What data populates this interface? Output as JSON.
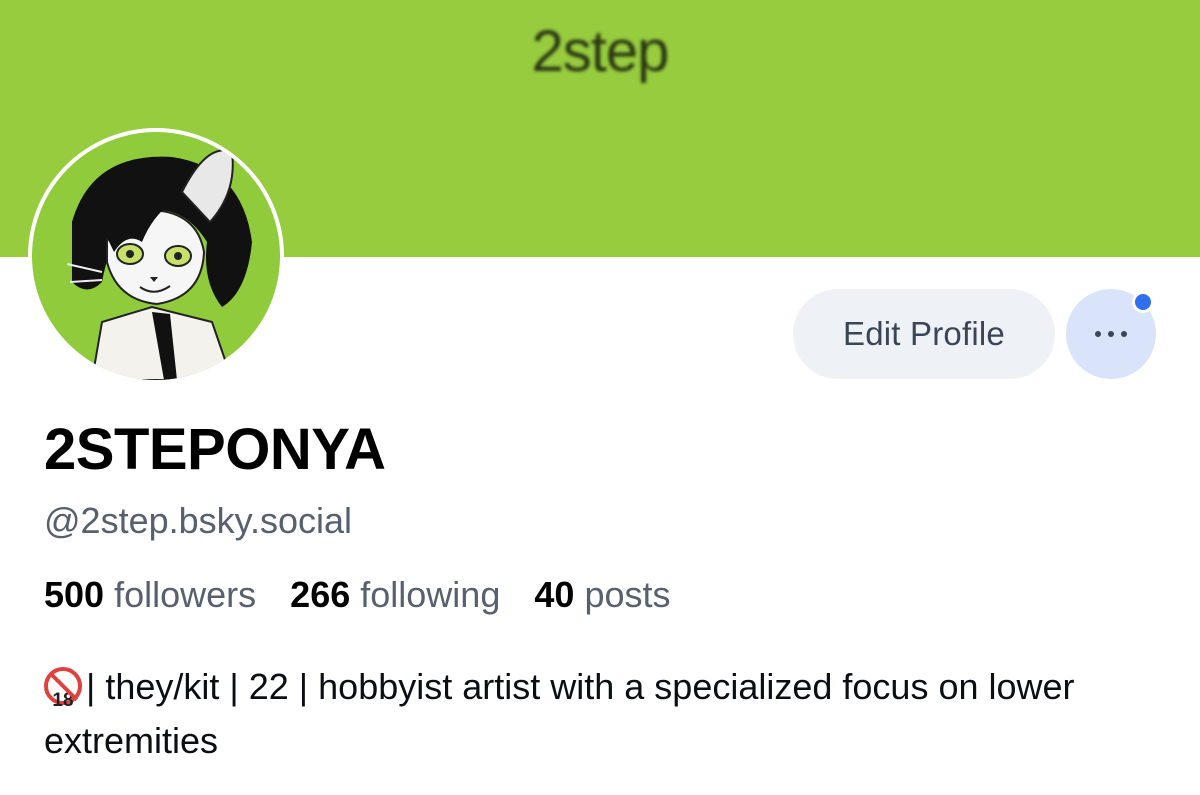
{
  "banner": {
    "text": "2step",
    "color": "#97cc3f"
  },
  "profile": {
    "display_name": "2STEPONYA",
    "handle": "@2step.bsky.social",
    "avatar_icon": "cartoon-cat-avatar"
  },
  "actions": {
    "edit_profile_label": "Edit Profile",
    "more_icon": "ellipsis-icon",
    "notification_dot_color": "#2f6ff0"
  },
  "stats": {
    "followers_count": "500",
    "followers_label": "followers",
    "following_count": "266",
    "following_label": "following",
    "posts_count": "40",
    "posts_label": "posts"
  },
  "bio": {
    "badge_icon": "no-under-18-icon",
    "badge_number": "18",
    "text": "| they/kit | 22 | hobbyist artist with a specialized focus on lower extremities"
  }
}
